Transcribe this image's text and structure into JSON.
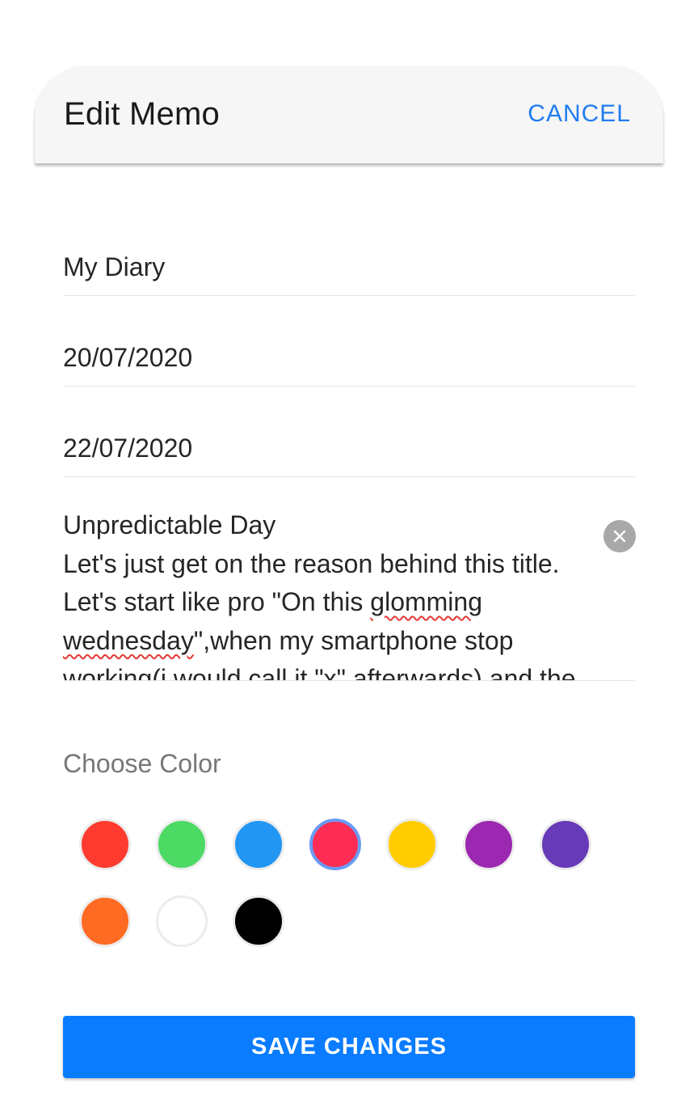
{
  "header": {
    "title": "Edit Memo",
    "cancel_label": "CANCEL"
  },
  "form": {
    "title_value": "My Diary",
    "start_date_value": "20/07/2020",
    "end_date_value": "22/07/2020",
    "memo": {
      "line1": "Unpredictable Day",
      "line2": "Let's just get on the reason behind this title.",
      "line3_a": "Let's start like pro \"On this ",
      "line3_b": "glomming",
      "line4_a": "wednesday",
      "line4_b": "\",when my smartphone stop",
      "line5": "working(i would call it \"x\" afterwards) and the"
    },
    "clear_icon": "close-circle-icon"
  },
  "colors": {
    "label": "Choose Color",
    "selected": "#ff2d55",
    "options": [
      "#ff3b30",
      "#4cd964",
      "#2196f3",
      "#ff2d55",
      "#ffcc00",
      "#9c27b0",
      "#673ab7",
      "#ff6b22",
      "#ffffff",
      "#000000"
    ]
  },
  "actions": {
    "save_label": "SAVE CHANGES"
  },
  "theme": {
    "accent": "#0a7cff",
    "header_bg": "#f6f6f6"
  }
}
